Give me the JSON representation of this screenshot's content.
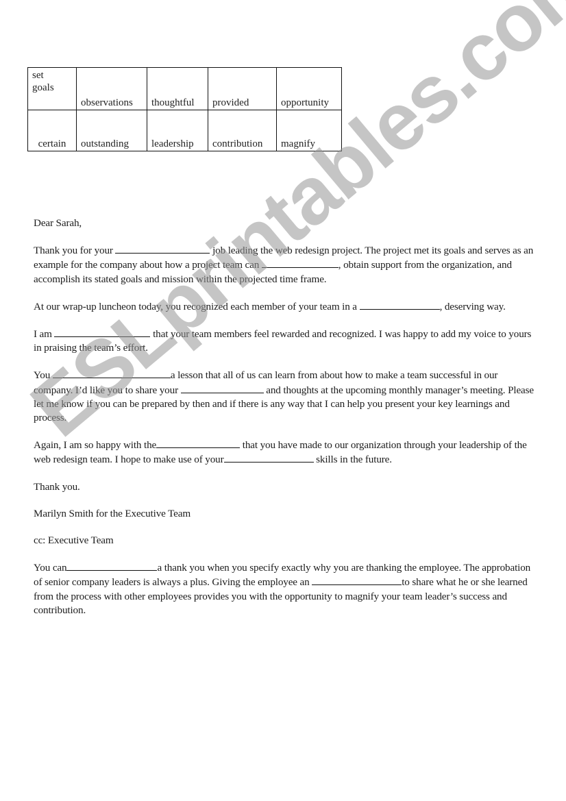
{
  "word_bank": {
    "rows": [
      [
        "set goals",
        "observations",
        "thoughtful",
        "provided",
        "opportunity"
      ],
      [
        "certain",
        "outstanding",
        "leadership",
        "contribution",
        "magnify"
      ]
    ]
  },
  "letter": {
    "greeting": "Dear Sarah,",
    "p1": {
      "a": "Thank you for your ",
      "b": " job leading the web redesign project. The project met its goals and serves as an example for the company about how a project team can ",
      "c": ", obtain support from the organization, and accomplish its stated goals and mission within the projected time frame."
    },
    "p2": {
      "a": "At our wrap-up luncheon today, you recognized each member of your team in a ",
      "b": ", deserving way."
    },
    "p3": {
      "a": "I am ",
      "b": " that your team members feel rewarded and recognized. I was happy to add my voice to yours in praising the team’s effort."
    },
    "p4": {
      "a": "You ",
      "b": "a lesson that all of us can learn from about how to make a team successful in our company. I’d like you to share your ",
      "c": " and thoughts at the upcoming monthly manager’s meeting. Please let me know if you can be prepared by then and if there is any way that I can help you present your key learnings and process."
    },
    "p5": {
      "a": "Again, I am so happy with the",
      "b": " that you have made to our organization through your leadership of the web redesign team. I hope to make use of your",
      "c": " skills in the future."
    },
    "closing": "Thank you.",
    "signature": "Marilyn Smith for the Executive Team",
    "cc": "cc: Executive Team"
  },
  "note": {
    "a": "You can",
    "b": "a thank you when you specify exactly why you are thanking the employee. The approbation of senior company leaders is always a plus. Giving the employee an ",
    "c": "to share what he or she learned from the process with other employees provides you with the opportunity to magnify your team leader’s success and contribution."
  },
  "watermark": "ESLprintables.com"
}
